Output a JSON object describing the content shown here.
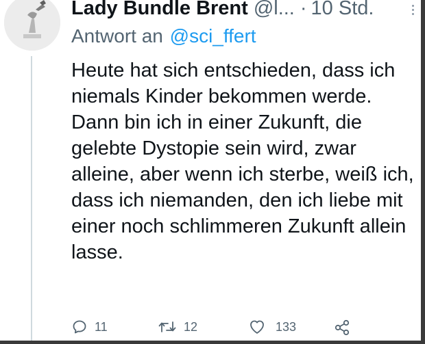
{
  "tweet": {
    "display_name": "Lady Bundle Brent",
    "handle": "@l...",
    "separator": "·",
    "time": "10 Std.",
    "reply_prefix": "Antwort an",
    "reply_to": "@sci_ffert",
    "text": "Heute hat sich entschieden, dass ich niemals Kinder bekommen werde. Dann bin ich in einer Zukunft, die gelebte Dystopie sein wird, zwar alleine, aber wenn ich sterbe, weiß ich, dass ich niemanden, den ich liebe mit einer noch schlimmeren Zukunft allein lasse."
  },
  "actions": {
    "reply": {
      "icon": "reply-icon",
      "count": "11"
    },
    "retweet": {
      "icon": "retweet-icon",
      "count": "12"
    },
    "like": {
      "icon": "heart-icon",
      "count": "133"
    },
    "share": {
      "icon": "share-icon"
    }
  },
  "colors": {
    "text": "#0f1419",
    "muted": "#536471",
    "link": "#1d9bf0",
    "thread_line": "#cfd9de"
  }
}
